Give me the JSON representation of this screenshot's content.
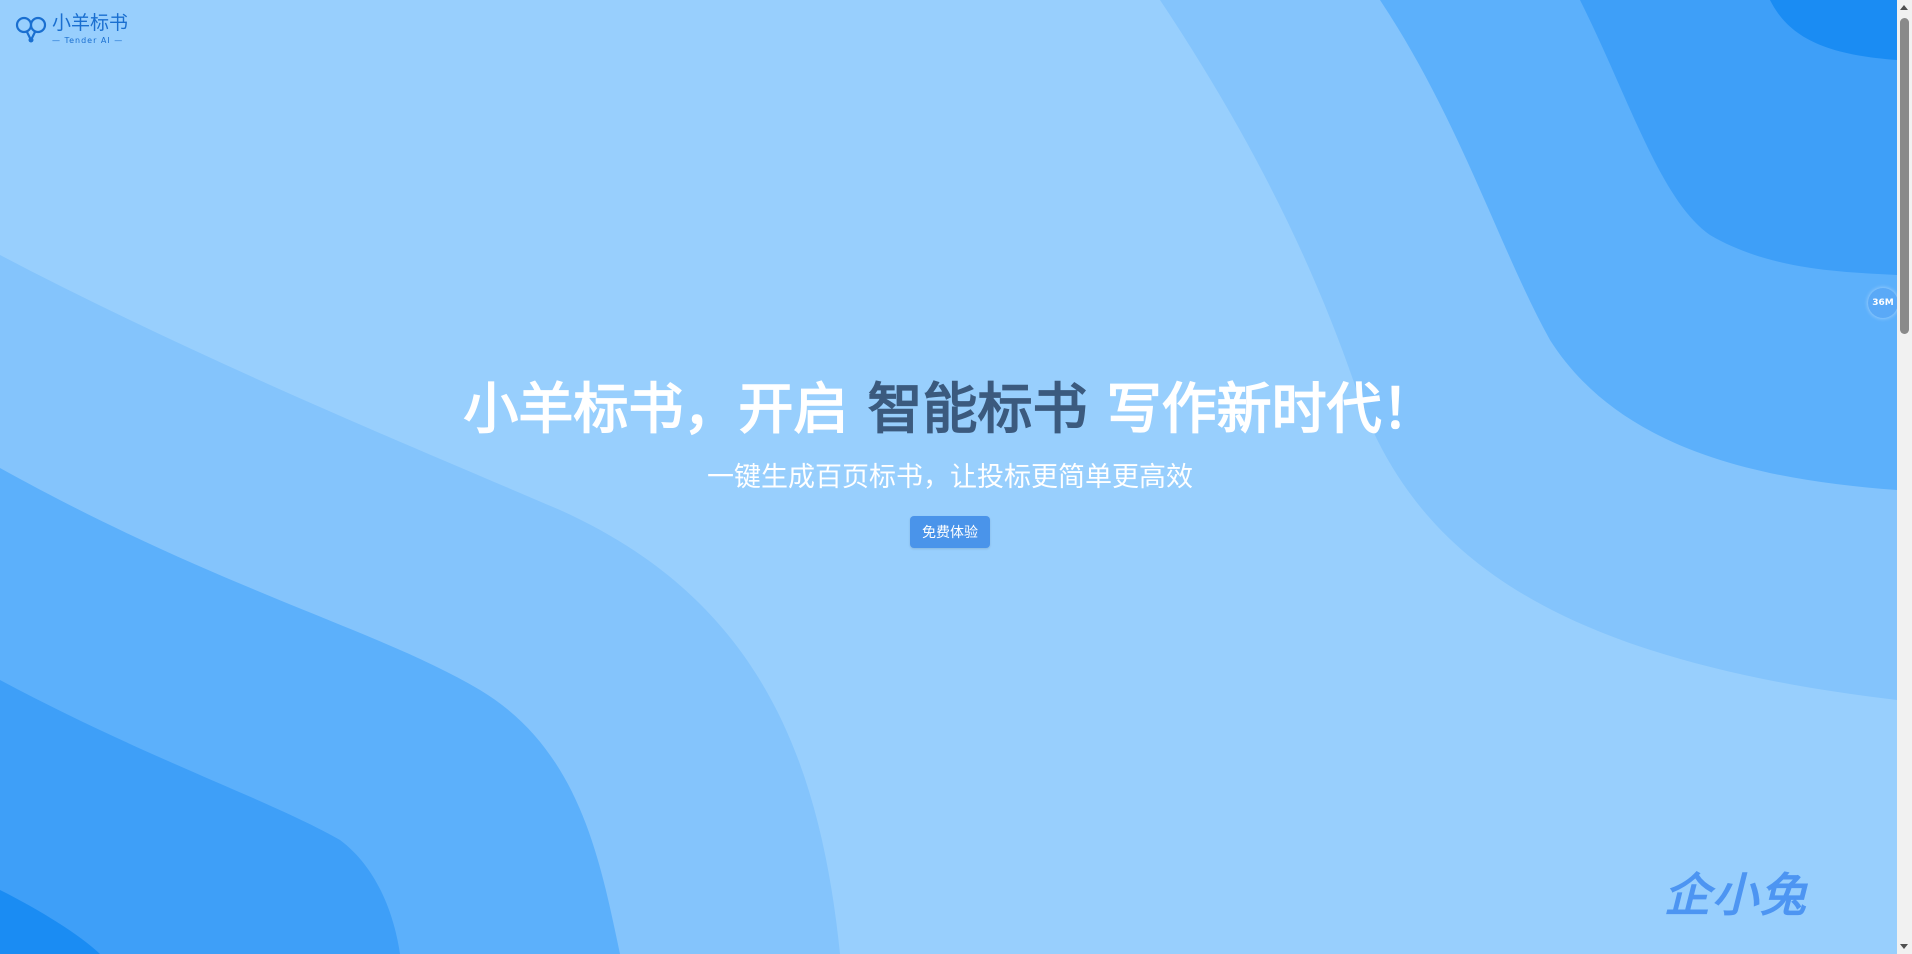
{
  "brand": {
    "name": "小羊标书",
    "subtitle": "— Tender AI —"
  },
  "hero": {
    "headline_part1": "小羊标书，开启 ",
    "headline_accent": "智能标书",
    "headline_part2": " 写作新时代！",
    "subline": "一键生成百页标书，让投标更简单更高效",
    "cta_label": "免费体验"
  },
  "side_badge": {
    "label": "36M"
  },
  "watermark": {
    "text": "企小兔"
  },
  "colors": {
    "background": "#98cffd",
    "accent_text": "#3b5a7e",
    "button": "#4a94ea",
    "brand": "#1a6fd0"
  },
  "icons": {
    "logo": "sheep-logo-icon",
    "scroll_up": "scroll-up-arrow-icon",
    "scroll_down": "scroll-down-arrow-icon"
  }
}
